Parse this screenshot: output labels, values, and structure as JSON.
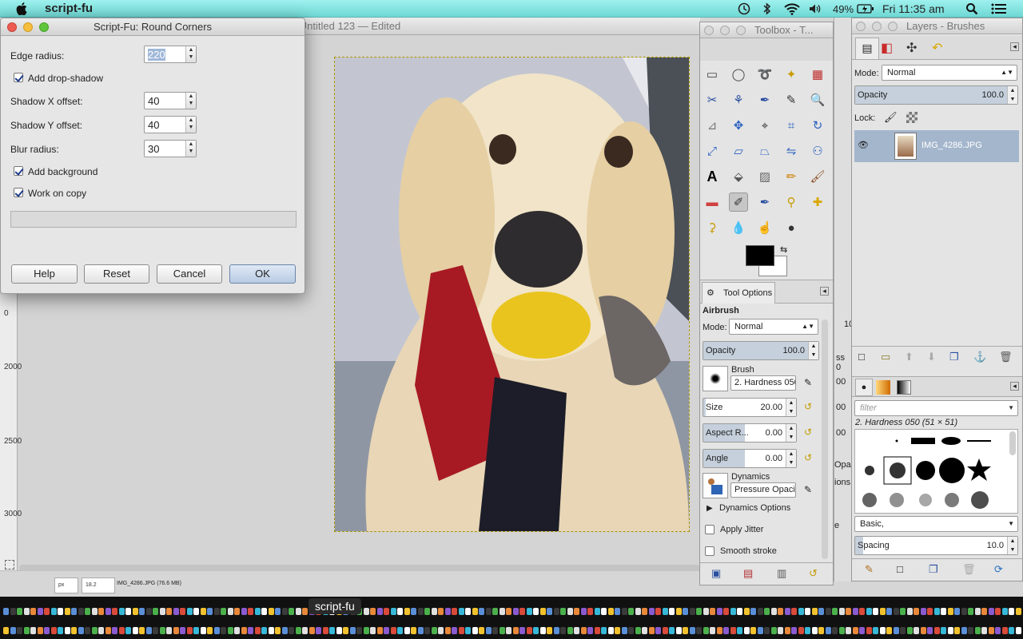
{
  "menubar": {
    "app_name": "script-fu",
    "status": {
      "battery": "49%",
      "clock": "Fri 11:35 am"
    }
  },
  "image_window": {
    "title": "Untitled 123 — Edited",
    "ruler_labels": [
      {
        "text": "0"
      },
      {
        "text": "2000"
      },
      {
        "text": "2500"
      },
      {
        "text": "3000"
      }
    ],
    "status": {
      "unit": "px",
      "zoom": "18.2",
      "file": "IMG_4286.JPG (76.6 MB)"
    }
  },
  "dialog": {
    "title": "Script-Fu: Round Corners",
    "fields": {
      "edge_radius": {
        "label": "Edge radius:",
        "value": "220"
      },
      "shadow_x": {
        "label": "Shadow X offset:",
        "value": "40"
      },
      "shadow_y": {
        "label": "Shadow Y offset:",
        "value": "40"
      },
      "blur": {
        "label": "Blur radius:",
        "value": "30"
      }
    },
    "checks": {
      "drop_shadow": {
        "label": "Add drop-shadow",
        "checked": true
      },
      "background": {
        "label": "Add background",
        "checked": true
      },
      "work_on_copy": {
        "label": "Work on copy",
        "checked": true
      }
    },
    "buttons": {
      "help": "Help",
      "reset": "Reset",
      "cancel": "Cancel",
      "ok": "OK"
    }
  },
  "toolbox": {
    "title": "Toolbox - T...",
    "tool_options_tab": "Tool Options",
    "tool_name": "Airbrush",
    "mode_label": "Mode:",
    "mode_value": "Normal",
    "opacity": {
      "label": "Opacity",
      "value": "100.0"
    },
    "brush_label": "Brush",
    "brush_value": "2. Hardness 050",
    "size": {
      "label": "Size",
      "value": "20.00"
    },
    "aspect": {
      "label": "Aspect R...",
      "value": "0.00"
    },
    "angle": {
      "label": "Angle",
      "value": "0.00"
    },
    "dynamics_label": "Dynamics",
    "dynamics_value": "Pressure Opacity",
    "dynamics_options": "Dynamics Options",
    "apply_jitter": "Apply Jitter",
    "smooth_stroke": "Smooth stroke"
  },
  "layers": {
    "title": "Layers - Brushes",
    "mode_label": "Mode:",
    "mode_value": "Normal",
    "opacity": {
      "label": "Opacity",
      "value": "100.0"
    },
    "lock_label": "Lock:",
    "layer_name": "IMG_4286.JPG",
    "filter_placeholder": "filter",
    "brush_title": "2. Hardness 050 (51 × 51)",
    "brush_tag": "Basic,",
    "spacing": {
      "label": "Spacing",
      "value": "10.0"
    }
  },
  "partial_panel": {
    "values": [
      {
        "text": "10"
      },
      {
        "text": "ss 0"
      },
      {
        "text": "00"
      },
      {
        "text": "00"
      },
      {
        "text": "00"
      },
      {
        "text": "Opac"
      },
      {
        "text": "ions"
      },
      {
        "text": "e"
      }
    ]
  },
  "dock": {
    "tooltip": "script-fu"
  }
}
